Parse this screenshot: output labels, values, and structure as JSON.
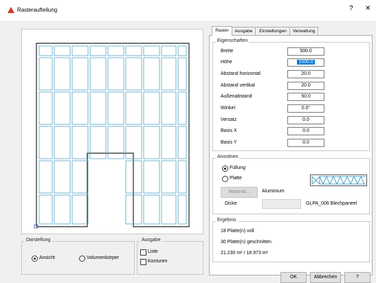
{
  "window": {
    "title": "Rasteraufteilung",
    "help": "?",
    "close": "✕"
  },
  "tabs": [
    "Raster",
    "Ausgabe",
    "Einstellungen",
    "Verwaltung"
  ],
  "eigenschaften": {
    "legend": "Eigenschaften",
    "rows": [
      {
        "label": "Breite",
        "value": "500.0"
      },
      {
        "label": "Höhe",
        "value": "1000.0"
      },
      {
        "label": "Abstand horizontal",
        "value": "20.0"
      },
      {
        "label": "Abstand vertikal",
        "value": "20.0"
      },
      {
        "label": "Außenabstand",
        "value": "50.0"
      },
      {
        "label": "Winkel",
        "value": "0.0°"
      },
      {
        "label": "Versatz",
        "value": "0.0"
      },
      {
        "label": "Basis X",
        "value": "0.0"
      },
      {
        "label": "Basis Y",
        "value": "0.0"
      }
    ]
  },
  "anordnen": {
    "legend": "Anordnen",
    "fuellung": "Füllung",
    "platte": "Platte",
    "material_button": "Material...",
    "material_value": "Aluminium",
    "dicke_label": "Dicke",
    "dicke_value": "",
    "product": "GLPA_006 Blechpaneel"
  },
  "ergebnis": {
    "legend": "Ergebnis",
    "line1": "18 Platte(n) voll",
    "line2": "30 Platte(n) geschnitten",
    "line3": "21.230 m² / 18.973 m²"
  },
  "darstellung": {
    "legend": "Darstellung",
    "ansicht": "Ansicht",
    "volumenkoerper": "Volumenkörper"
  },
  "ausgabe": {
    "legend": "Ausgabe",
    "liste": "Liste",
    "konturen": "Konturen"
  },
  "buttons": {
    "ok": "OK",
    "abbrechen": "Abbrechen",
    "help": "?"
  },
  "colors": {
    "panel_stroke": "#4fa3c6",
    "outline": "#222222",
    "accent": "#0078d7"
  }
}
